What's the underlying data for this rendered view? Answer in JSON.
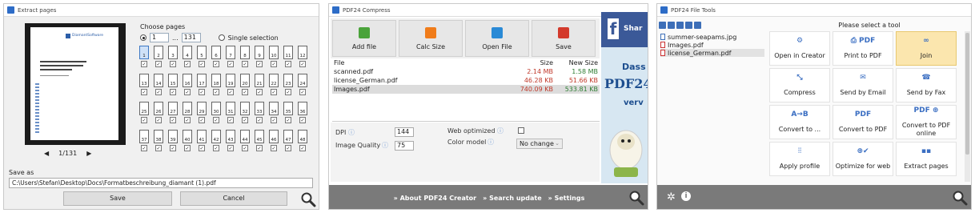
{
  "extract": {
    "title": "Extract pages",
    "choose_pages": "Choose pages",
    "range_from": "1",
    "range_sep": "...",
    "range_to": "131",
    "single_selection": "Single selection",
    "page_indicator": "1/131",
    "prev": "◀",
    "next": "▶",
    "doc_logo": "DiamantSoftware",
    "pages": [
      "1",
      "2",
      "3",
      "4",
      "5",
      "6",
      "7",
      "8",
      "9",
      "10",
      "11",
      "12",
      "13",
      "14",
      "15",
      "16",
      "17",
      "18",
      "19",
      "20",
      "21",
      "22",
      "23",
      "24",
      "25",
      "26",
      "27",
      "28",
      "29",
      "30",
      "31",
      "32",
      "33",
      "34",
      "35",
      "36",
      "37",
      "38",
      "39",
      "40",
      "41",
      "42",
      "43",
      "44",
      "45",
      "46",
      "47",
      "48"
    ],
    "save_as_label": "Save as",
    "save_path": "C:\\Users\\Stefan\\Desktop\\Docs\\Formatbeschreibung_diamant (1).pdf",
    "save_button": "Save",
    "cancel_button": "Cancel"
  },
  "compress": {
    "title": "PDF24 Compress",
    "toolbar": [
      {
        "label": "Add file",
        "icon": "add-file-icon",
        "color": "#4aa33a"
      },
      {
        "label": "Calc Size",
        "icon": "calc-size-icon",
        "color": "#f07c1a"
      },
      {
        "label": "Open File",
        "icon": "open-file-icon",
        "color": "#2a8ad6"
      },
      {
        "label": "Save",
        "icon": "save-pdf-icon",
        "color": "#d33a2c"
      }
    ],
    "columns": {
      "file": "File",
      "size": "Size",
      "new_size": "New Size"
    },
    "files": [
      {
        "name": "scanned.pdf",
        "size": "2.14 MB",
        "new_size": "1.58 MB"
      },
      {
        "name": "license_German.pdf",
        "size": "46.28 KB",
        "new_size": "51.66 KB"
      },
      {
        "name": "Images.pdf",
        "size": "740.09 KB",
        "new_size": "533.81 KB"
      }
    ],
    "dpi_label": "DPI",
    "dpi_value": "144",
    "quality_label": "Image Quality",
    "quality_value": "75",
    "web_optimized_label": "Web optimized",
    "color_model_label": "Color model",
    "color_model_value": "No change",
    "ad_text_1": "Shar",
    "ad_text_2": "Dass",
    "ad_text_3": "PDF24",
    "ad_text_4": "verv",
    "footer_about": "» About PDF24 Creator",
    "footer_search": "» Search update",
    "footer_settings": "» Settings"
  },
  "filetools": {
    "title": "PDF24 File Tools",
    "files": [
      "summer-seapams.jpg",
      "Images.pdf",
      "license_German.pdf"
    ],
    "select_prompt": "Please select a tool",
    "tools": [
      {
        "label": "Open in Creator",
        "icon": "open-creator-icon",
        "glyph": "⚙"
      },
      {
        "label": "Print to PDF",
        "icon": "print-pdf-icon",
        "glyph": "⎙ PDF"
      },
      {
        "label": "Join",
        "icon": "join-icon",
        "glyph": "∞"
      },
      {
        "label": "Compress",
        "icon": "compress-icon",
        "glyph": "⤡"
      },
      {
        "label": "Send by Email",
        "icon": "email-icon",
        "glyph": "✉"
      },
      {
        "label": "Send by Fax",
        "icon": "fax-icon",
        "glyph": "☎"
      },
      {
        "label": "Convert to ...",
        "icon": "convert-to-icon",
        "glyph": "A→B"
      },
      {
        "label": "Convert to PDF",
        "icon": "convert-pdf-icon",
        "glyph": "PDF"
      },
      {
        "label": "Convert to PDF online",
        "icon": "convert-pdf-online-icon",
        "glyph": "PDF ⊕"
      },
      {
        "label": "Apply profile",
        "icon": "apply-profile-icon",
        "glyph": "⫶⫶"
      },
      {
        "label": "Optimize for web",
        "icon": "optimize-web-icon",
        "glyph": "⊕✔"
      },
      {
        "label": "Extract pages",
        "icon": "extract-pages-icon",
        "glyph": "▪▪"
      }
    ],
    "active_tool": "Join",
    "accent_color": "#fbe6ae"
  }
}
